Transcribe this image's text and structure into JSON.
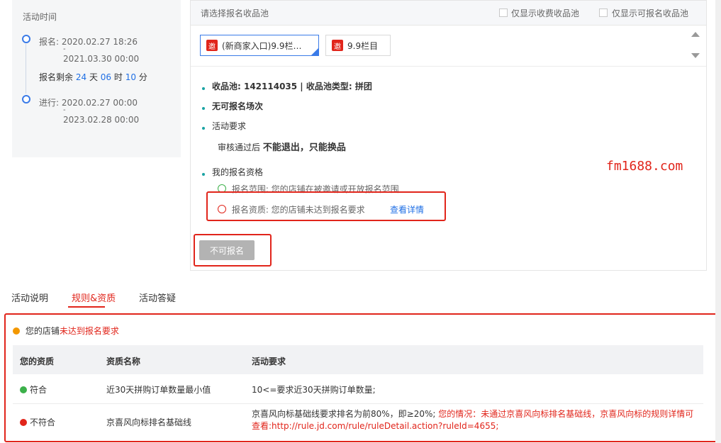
{
  "timeline": {
    "title": "活动时间",
    "signup_label": "报名:",
    "signup_start": "2020.02.27 18:26",
    "dash": "-",
    "signup_end": "2021.03.30 00:00",
    "remaining_prefix": "报名剩余",
    "remaining_days": "24",
    "days_unit": "天",
    "remaining_hours": "06",
    "hours_unit": "时",
    "remaining_minutes": "10",
    "minutes_unit": "分",
    "progress_label": "进行:",
    "progress_start": "2020.02.27 00:00",
    "progress_end": "2023.02.28 00:00"
  },
  "pool": {
    "header": "请选择报名收品池",
    "filter_fee": "仅显示收费收品池",
    "filter_signup": "仅显示可报名收品池",
    "tabs": [
      {
        "badge": "邀",
        "label": "(新商家入口)9.9栏…"
      },
      {
        "badge": "邀",
        "label": "9.9栏目"
      }
    ]
  },
  "details": {
    "pool_info": "收品池: 142114035 | 收品池类型: 拼团",
    "no_session": "无可报名场次",
    "req_title": "活动要求",
    "req_prefix": "审核通过后",
    "req_bold": "不能退出，只能换品",
    "my_qual": "我的报名资格",
    "scope": "报名范围: 您的店铺在被邀请或开放报名范围",
    "quality": "报名资质: 您的店铺未达到报名要求",
    "view_detail": "查看详情",
    "button": "不可报名"
  },
  "watermark": "fm1688.com",
  "tabs": [
    "活动说明",
    "规则&资质",
    "活动答疑"
  ],
  "notice": {
    "prefix": "您的店铺",
    "highlight": "未达到报名要求"
  },
  "table": {
    "headers": [
      "您的资质",
      "资质名称",
      "活动要求"
    ],
    "rows": [
      {
        "status": "符合",
        "name": "近30天拼购订单数量最小值",
        "req": "10<=要求近30天拼购订单数量;",
        "req_red": ""
      },
      {
        "status": "不符合",
        "name": "京喜风向标排名基础线",
        "req": "京喜风向标基础线要求排名为前80%，即≥20%;",
        "req_red": "您的情况：未通过京喜风向标排名基础线，京喜风向标的规则详情可查看:http://rule.jd.com/rule/ruleDetail.action?ruleId=4655;"
      }
    ]
  },
  "colors": {
    "accent_red": "#e1251b",
    "accent_blue": "#1f6fe5",
    "ok_green": "#3cb04a",
    "warn_orange": "#f39800"
  }
}
